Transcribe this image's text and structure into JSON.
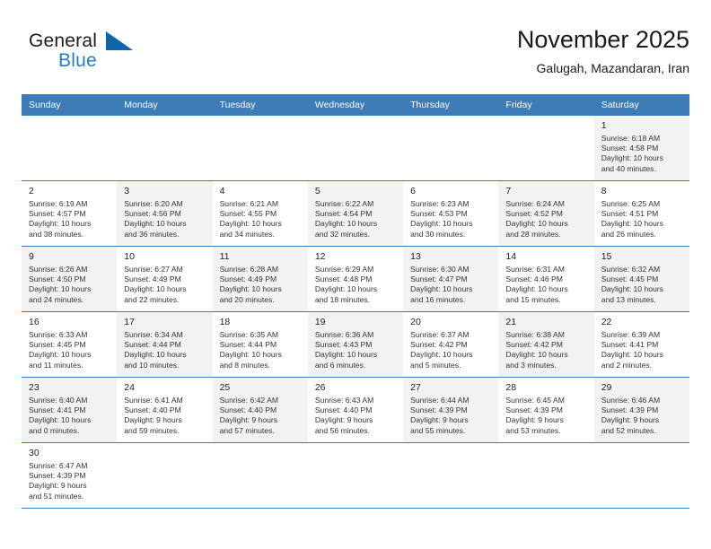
{
  "brand": {
    "name_part1": "General",
    "name_part2": "Blue",
    "flag_icon": "triangle-flag-icon",
    "accent_color": "#1e7fc4"
  },
  "header": {
    "title": "November 2025",
    "subtitle": "Galugah, Mazandaran, Iran"
  },
  "calendar": {
    "header_bg": "#3d7cb6",
    "weekday_headers": [
      "Sunday",
      "Monday",
      "Tuesday",
      "Wednesday",
      "Thursday",
      "Friday",
      "Saturday"
    ],
    "weeks": [
      [
        {
          "empty": true
        },
        {
          "empty": true
        },
        {
          "empty": true
        },
        {
          "empty": true
        },
        {
          "empty": true
        },
        {
          "empty": true
        },
        {
          "day": "1",
          "sunrise": "Sunrise: 6:18 AM",
          "sunset": "Sunset: 4:58 PM",
          "daylight_1": "Daylight: 10 hours",
          "daylight_2": "and 40 minutes."
        }
      ],
      [
        {
          "day": "2",
          "sunrise": "Sunrise: 6:19 AM",
          "sunset": "Sunset: 4:57 PM",
          "daylight_1": "Daylight: 10 hours",
          "daylight_2": "and 38 minutes."
        },
        {
          "day": "3",
          "sunrise": "Sunrise: 6:20 AM",
          "sunset": "Sunset: 4:56 PM",
          "daylight_1": "Daylight: 10 hours",
          "daylight_2": "and 36 minutes."
        },
        {
          "day": "4",
          "sunrise": "Sunrise: 6:21 AM",
          "sunset": "Sunset: 4:55 PM",
          "daylight_1": "Daylight: 10 hours",
          "daylight_2": "and 34 minutes."
        },
        {
          "day": "5",
          "sunrise": "Sunrise: 6:22 AM",
          "sunset": "Sunset: 4:54 PM",
          "daylight_1": "Daylight: 10 hours",
          "daylight_2": "and 32 minutes."
        },
        {
          "day": "6",
          "sunrise": "Sunrise: 6:23 AM",
          "sunset": "Sunset: 4:53 PM",
          "daylight_1": "Daylight: 10 hours",
          "daylight_2": "and 30 minutes."
        },
        {
          "day": "7",
          "sunrise": "Sunrise: 6:24 AM",
          "sunset": "Sunset: 4:52 PM",
          "daylight_1": "Daylight: 10 hours",
          "daylight_2": "and 28 minutes."
        },
        {
          "day": "8",
          "sunrise": "Sunrise: 6:25 AM",
          "sunset": "Sunset: 4:51 PM",
          "daylight_1": "Daylight: 10 hours",
          "daylight_2": "and 26 minutes."
        }
      ],
      [
        {
          "day": "9",
          "sunrise": "Sunrise: 6:26 AM",
          "sunset": "Sunset: 4:50 PM",
          "daylight_1": "Daylight: 10 hours",
          "daylight_2": "and 24 minutes."
        },
        {
          "day": "10",
          "sunrise": "Sunrise: 6:27 AM",
          "sunset": "Sunset: 4:49 PM",
          "daylight_1": "Daylight: 10 hours",
          "daylight_2": "and 22 minutes."
        },
        {
          "day": "11",
          "sunrise": "Sunrise: 6:28 AM",
          "sunset": "Sunset: 4:49 PM",
          "daylight_1": "Daylight: 10 hours",
          "daylight_2": "and 20 minutes."
        },
        {
          "day": "12",
          "sunrise": "Sunrise: 6:29 AM",
          "sunset": "Sunset: 4:48 PM",
          "daylight_1": "Daylight: 10 hours",
          "daylight_2": "and 18 minutes."
        },
        {
          "day": "13",
          "sunrise": "Sunrise: 6:30 AM",
          "sunset": "Sunset: 4:47 PM",
          "daylight_1": "Daylight: 10 hours",
          "daylight_2": "and 16 minutes."
        },
        {
          "day": "14",
          "sunrise": "Sunrise: 6:31 AM",
          "sunset": "Sunset: 4:46 PM",
          "daylight_1": "Daylight: 10 hours",
          "daylight_2": "and 15 minutes."
        },
        {
          "day": "15",
          "sunrise": "Sunrise: 6:32 AM",
          "sunset": "Sunset: 4:45 PM",
          "daylight_1": "Daylight: 10 hours",
          "daylight_2": "and 13 minutes."
        }
      ],
      [
        {
          "day": "16",
          "sunrise": "Sunrise: 6:33 AM",
          "sunset": "Sunset: 4:45 PM",
          "daylight_1": "Daylight: 10 hours",
          "daylight_2": "and 11 minutes."
        },
        {
          "day": "17",
          "sunrise": "Sunrise: 6:34 AM",
          "sunset": "Sunset: 4:44 PM",
          "daylight_1": "Daylight: 10 hours",
          "daylight_2": "and 10 minutes."
        },
        {
          "day": "18",
          "sunrise": "Sunrise: 6:35 AM",
          "sunset": "Sunset: 4:44 PM",
          "daylight_1": "Daylight: 10 hours",
          "daylight_2": "and 8 minutes."
        },
        {
          "day": "19",
          "sunrise": "Sunrise: 6:36 AM",
          "sunset": "Sunset: 4:43 PM",
          "daylight_1": "Daylight: 10 hours",
          "daylight_2": "and 6 minutes."
        },
        {
          "day": "20",
          "sunrise": "Sunrise: 6:37 AM",
          "sunset": "Sunset: 4:42 PM",
          "daylight_1": "Daylight: 10 hours",
          "daylight_2": "and 5 minutes."
        },
        {
          "day": "21",
          "sunrise": "Sunrise: 6:38 AM",
          "sunset": "Sunset: 4:42 PM",
          "daylight_1": "Daylight: 10 hours",
          "daylight_2": "and 3 minutes."
        },
        {
          "day": "22",
          "sunrise": "Sunrise: 6:39 AM",
          "sunset": "Sunset: 4:41 PM",
          "daylight_1": "Daylight: 10 hours",
          "daylight_2": "and 2 minutes."
        }
      ],
      [
        {
          "day": "23",
          "sunrise": "Sunrise: 6:40 AM",
          "sunset": "Sunset: 4:41 PM",
          "daylight_1": "Daylight: 10 hours",
          "daylight_2": "and 0 minutes."
        },
        {
          "day": "24",
          "sunrise": "Sunrise: 6:41 AM",
          "sunset": "Sunset: 4:40 PM",
          "daylight_1": "Daylight: 9 hours",
          "daylight_2": "and 59 minutes."
        },
        {
          "day": "25",
          "sunrise": "Sunrise: 6:42 AM",
          "sunset": "Sunset: 4:40 PM",
          "daylight_1": "Daylight: 9 hours",
          "daylight_2": "and 57 minutes."
        },
        {
          "day": "26",
          "sunrise": "Sunrise: 6:43 AM",
          "sunset": "Sunset: 4:40 PM",
          "daylight_1": "Daylight: 9 hours",
          "daylight_2": "and 56 minutes."
        },
        {
          "day": "27",
          "sunrise": "Sunrise: 6:44 AM",
          "sunset": "Sunset: 4:39 PM",
          "daylight_1": "Daylight: 9 hours",
          "daylight_2": "and 55 minutes."
        },
        {
          "day": "28",
          "sunrise": "Sunrise: 6:45 AM",
          "sunset": "Sunset: 4:39 PM",
          "daylight_1": "Daylight: 9 hours",
          "daylight_2": "and 53 minutes."
        },
        {
          "day": "29",
          "sunrise": "Sunrise: 6:46 AM",
          "sunset": "Sunset: 4:39 PM",
          "daylight_1": "Daylight: 9 hours",
          "daylight_2": "and 52 minutes."
        }
      ],
      [
        {
          "day": "30",
          "sunrise": "Sunrise: 6:47 AM",
          "sunset": "Sunset: 4:39 PM",
          "daylight_1": "Daylight: 9 hours",
          "daylight_2": "and 51 minutes."
        },
        {
          "empty": true
        },
        {
          "empty": true
        },
        {
          "empty": true
        },
        {
          "empty": true
        },
        {
          "empty": true
        },
        {
          "empty": true
        }
      ]
    ]
  }
}
